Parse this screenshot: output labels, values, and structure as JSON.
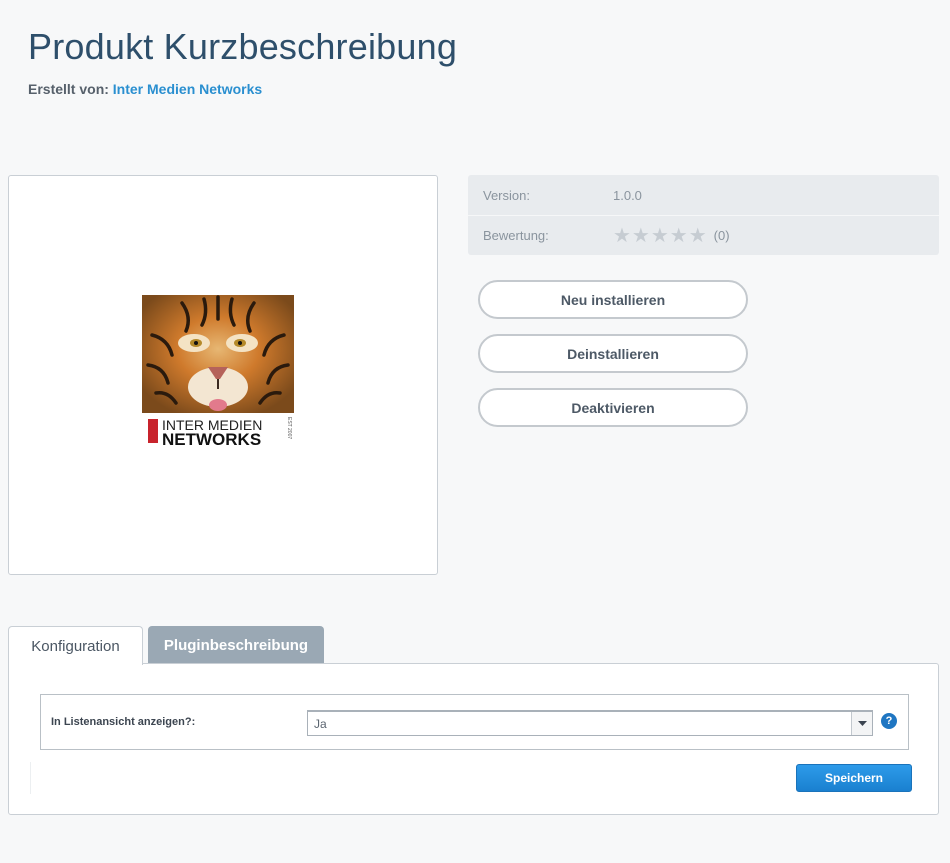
{
  "header": {
    "title": "Produkt Kurzbeschreibung",
    "author_prefix": "Erstellt von:",
    "author_name": "Inter Medien Networks"
  },
  "logo": {
    "line1": "INTER MEDIEN",
    "line2": "NETWORKS",
    "est": "EST 2007"
  },
  "info": {
    "version_label": "Version:",
    "version_value": "1.0.0",
    "rating_label": "Bewertung:",
    "rating_stars": "★★★★★",
    "rating_count": "(0)",
    "rating_value": 0,
    "rating_max": 5
  },
  "actions": {
    "reinstall_label": "Neu installieren",
    "uninstall_label": "Deinstallieren",
    "deactivate_label": "Deaktivieren"
  },
  "tabs": [
    {
      "label": "Konfiguration",
      "active": true
    },
    {
      "label": "Pluginbeschreibung",
      "active": false
    }
  ],
  "config": {
    "field_label": "In Listenansicht anzeigen?:",
    "field_value": "Ja",
    "help_symbol": "?",
    "save_label": "Speichern"
  },
  "colors": {
    "title": "#2e4f6b",
    "link": "#2a8fd0",
    "save_button": "#1a80d0",
    "tab_inactive": "#9aa8b4"
  }
}
